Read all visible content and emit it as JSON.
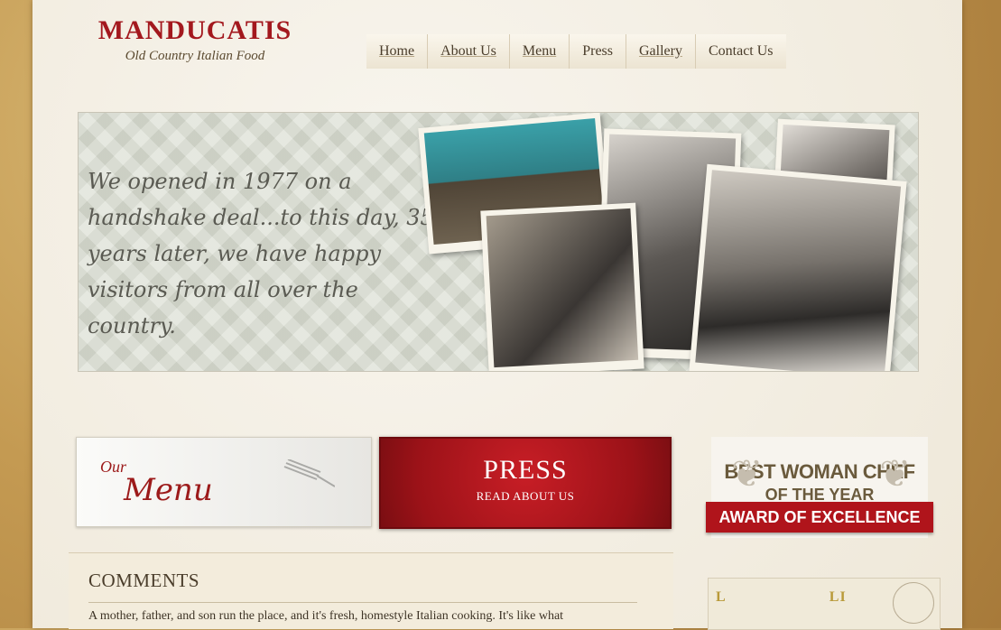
{
  "logo": {
    "name": "MANDUCATIS",
    "tagline": "Old Country Italian Food"
  },
  "nav": {
    "items": [
      {
        "label": "Home"
      },
      {
        "label": "About Us"
      },
      {
        "label": "Menu"
      },
      {
        "label": "Press"
      },
      {
        "label": "Gallery"
      },
      {
        "label": "Contact Us"
      }
    ]
  },
  "banner": {
    "quote": "We opened in 1977 on a handshake deal...to this day, 35 years later, we have happy visitors from all over the country."
  },
  "features": {
    "menu": {
      "small": "Our",
      "big": "Menu"
    },
    "press": {
      "title": "PRESS",
      "subtitle": "READ ABOUT US"
    },
    "award": {
      "line1": "BEST WOMAN CHEF",
      "line2": "OF THE YEAR",
      "ribbon": "AWARD OF EXCELLENCE"
    }
  },
  "comments": {
    "heading": "COMMENTS",
    "text": "A mother, father, and son run the place, and it's fresh, homestyle Italian cooking. It's like what"
  },
  "side": {
    "label": "L",
    "label_end": "LI",
    "link": ""
  },
  "colors": {
    "brand_red": "#a3181e",
    "press_red": "#c81e26",
    "background": "#f1ebdd"
  }
}
